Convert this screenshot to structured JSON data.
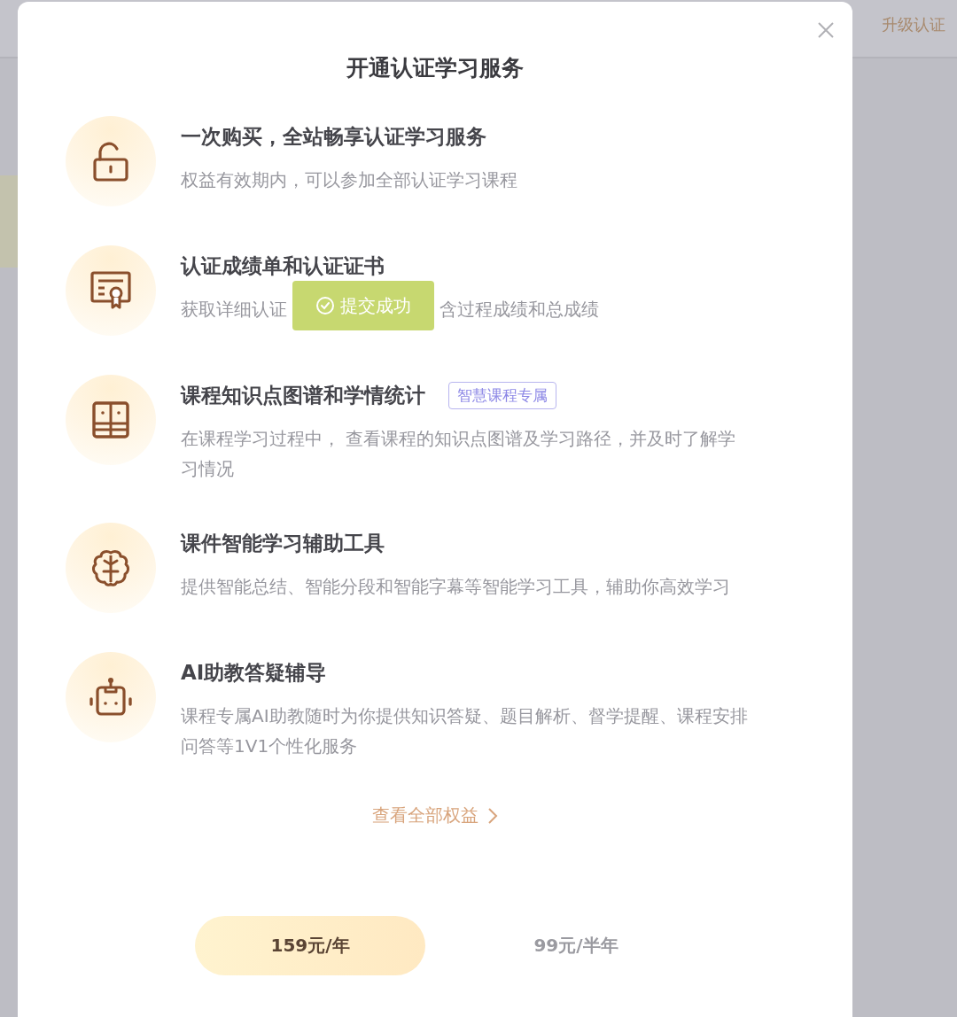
{
  "background": {
    "top_right_link": "升级认证"
  },
  "dialog": {
    "title": "开通认证学习服务",
    "benefits": [
      {
        "title": "一次购买，全站畅享认证学习服务",
        "description": [
          "权益有效期内，可以参加全部认证学习课程"
        ]
      },
      {
        "title": "认证成绩单和认证证书",
        "description": [
          "获取详细认证",
          "含过程成绩和总成绩"
        ]
      },
      {
        "title": "课程知识点图谱和学情统计",
        "tag": "智慧课程专属",
        "description": [
          "在课程学习过程中， 查看课程的知识点图谱及学习路径，并及时了解学习情况"
        ]
      },
      {
        "title": "课件智能学习辅助工具",
        "description": [
          "提供智能总结、智能分段和智能字幕等智能学习工具，辅助你高效学习"
        ]
      },
      {
        "title": "AI助教答疑辅导",
        "description": [
          "课程专属AI助教随时为你提供知识答疑、题目解析、督学提醒、课程安排问答等1V1个性化服务"
        ]
      }
    ],
    "more_link": "查看全部权益",
    "plans": [
      {
        "label": "159元/年",
        "selected": true
      },
      {
        "label": "99元/半年",
        "selected": false
      }
    ]
  },
  "toast": {
    "text": "提交成功"
  }
}
